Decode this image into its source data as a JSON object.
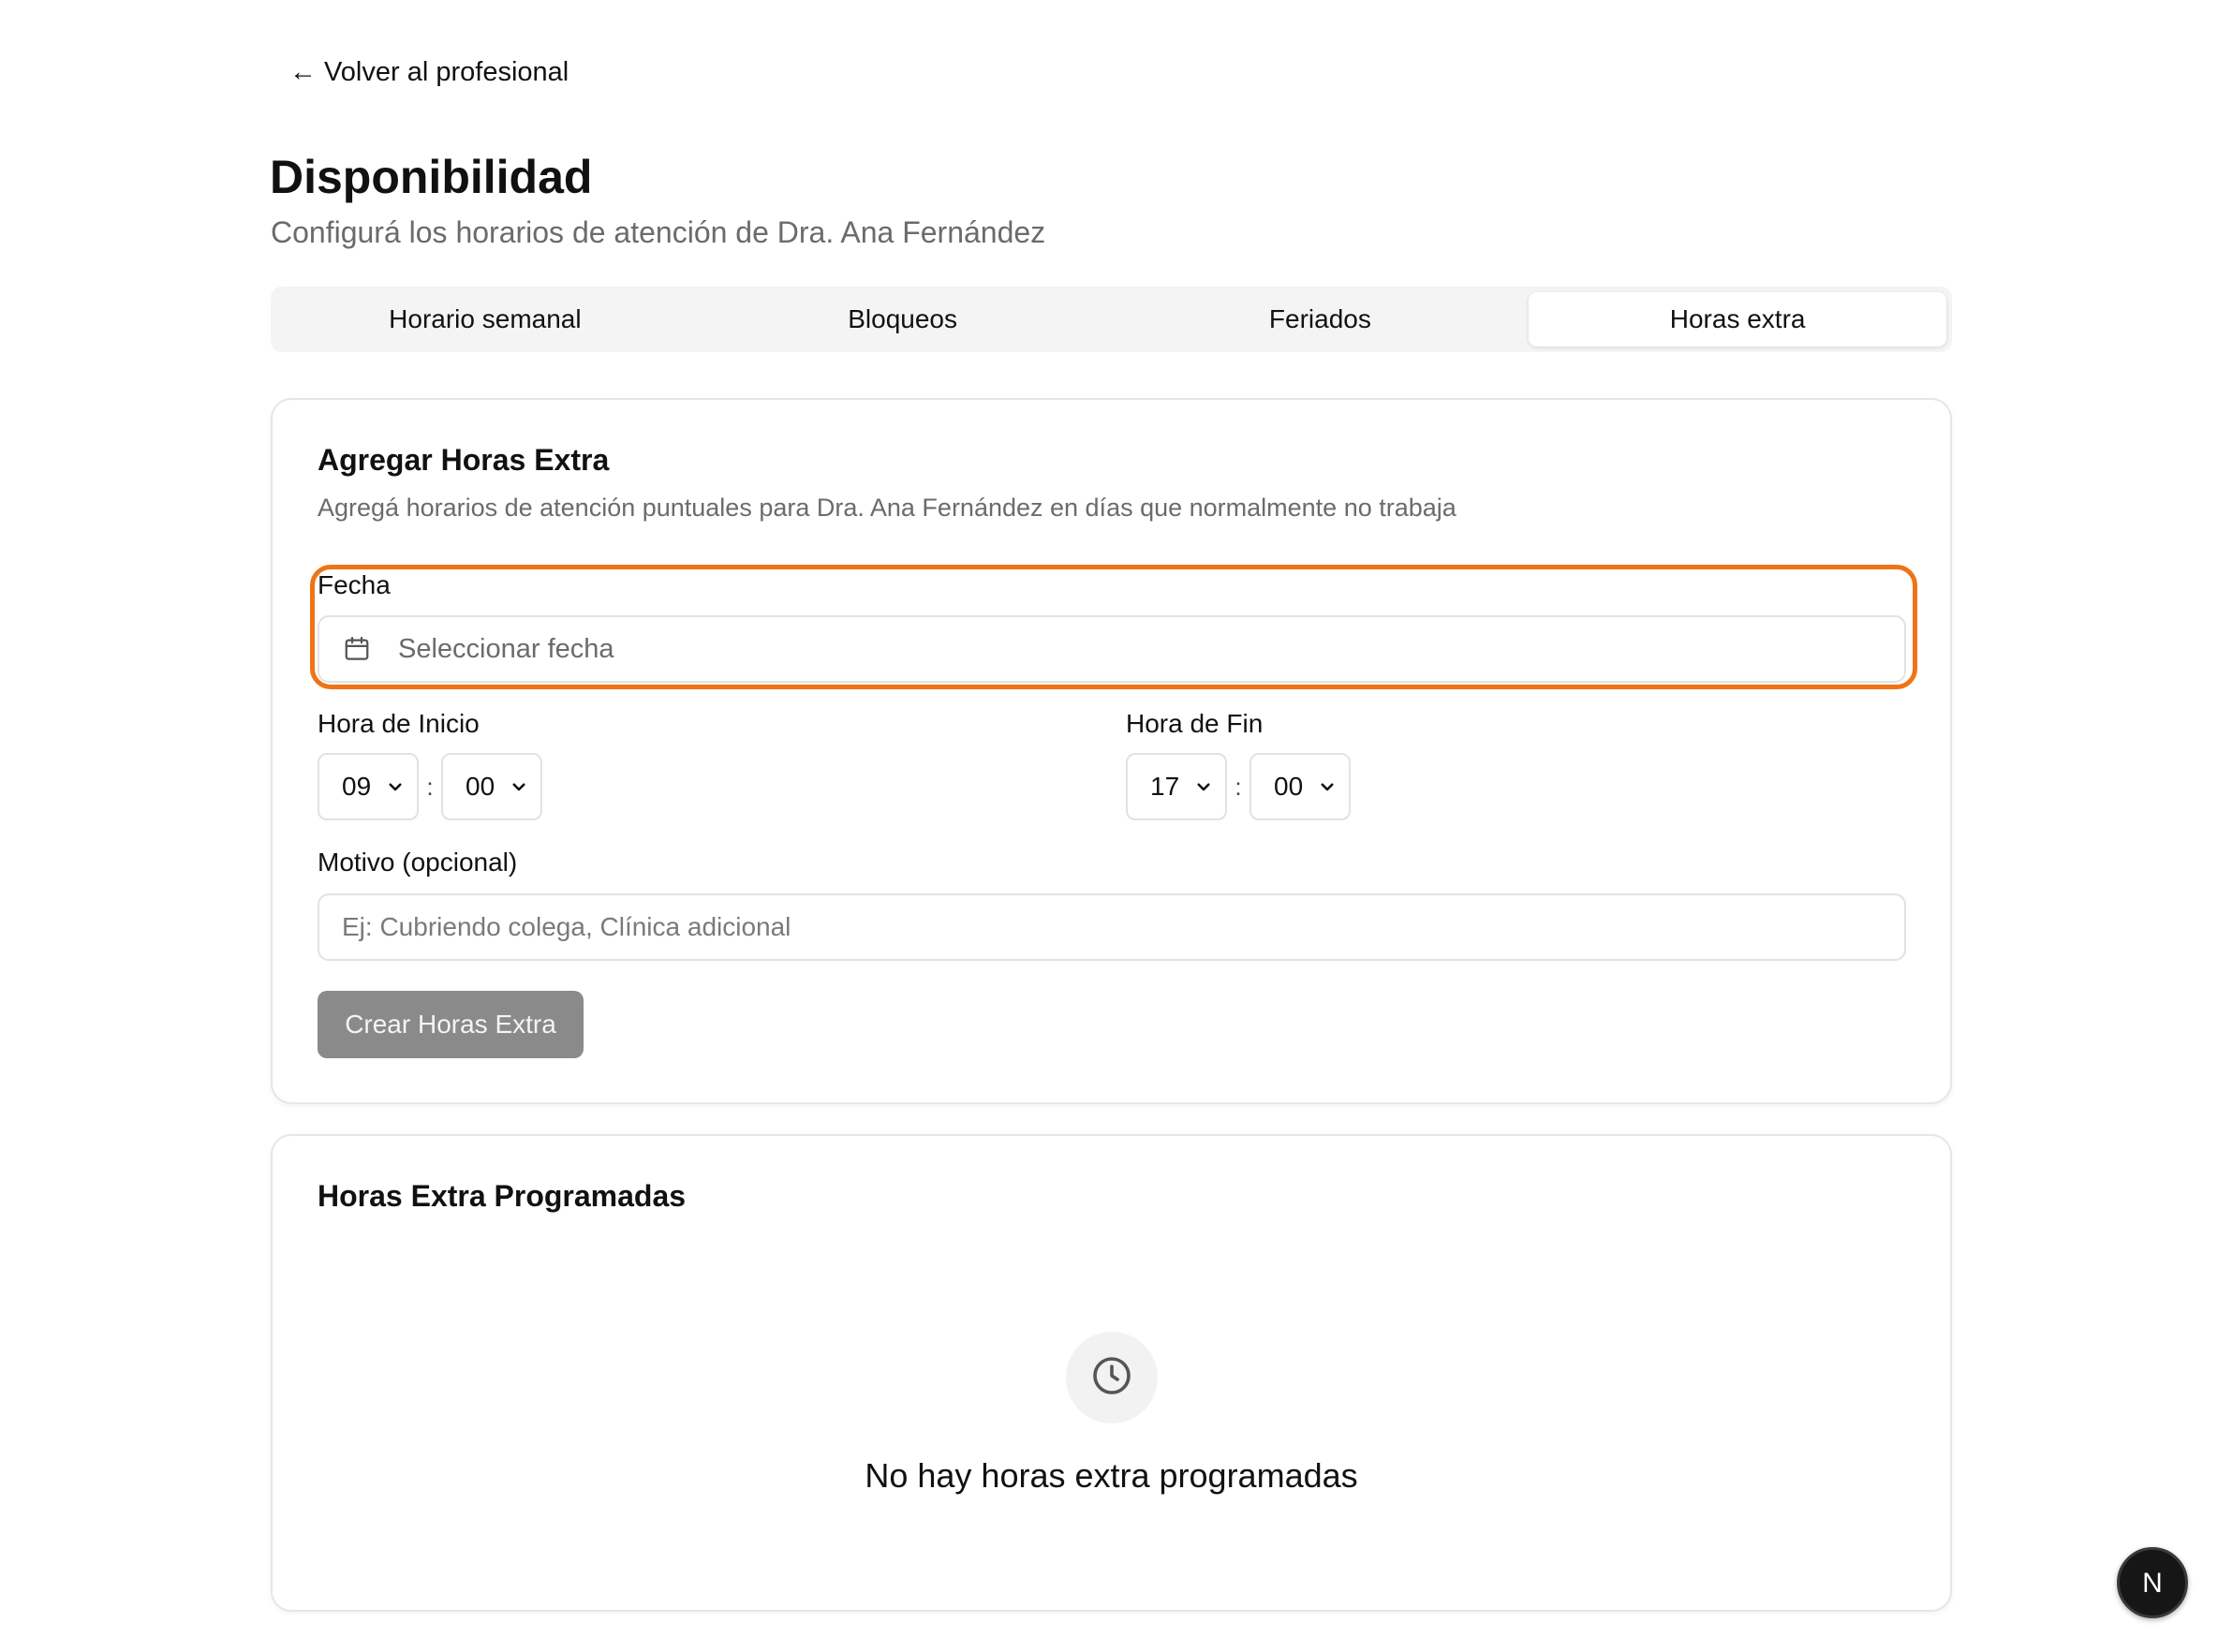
{
  "back_link": {
    "label": "← Volver al profesional"
  },
  "header": {
    "title": "Disponibilidad",
    "subtitle": "Configurá los horarios de atención de Dra. Ana Fernández"
  },
  "tabs": [
    {
      "label": "Horario semanal",
      "active": false
    },
    {
      "label": "Bloqueos",
      "active": false
    },
    {
      "label": "Feriados",
      "active": false
    },
    {
      "label": "Horas extra",
      "active": true
    }
  ],
  "form": {
    "title": "Agregar Horas Extra",
    "description": "Agregá horarios de atención puntuales para Dra. Ana Fernández en días que normalmente no trabaja",
    "date": {
      "label": "Fecha",
      "placeholder": "Seleccionar fecha",
      "icon": "calendar-icon"
    },
    "start_time": {
      "label": "Hora de Inicio",
      "hour": "09",
      "minute": "00",
      "separator": ":"
    },
    "end_time": {
      "label": "Hora de Fin",
      "hour": "17",
      "minute": "00",
      "separator": ":"
    },
    "reason": {
      "label": "Motivo (opcional)",
      "placeholder": "Ej: Cubriendo colega, Clínica adicional",
      "value": ""
    },
    "submit_label": "Crear Horas Extra"
  },
  "scheduled": {
    "title": "Horas Extra Programadas",
    "empty_icon": "clock-icon",
    "empty_text": "No hay horas extra programadas"
  },
  "floating_button": {
    "label": "N"
  },
  "colors": {
    "highlight": "#f07316",
    "button_disabled": "#8a8a8a",
    "tab_bg": "#f4f4f5"
  }
}
